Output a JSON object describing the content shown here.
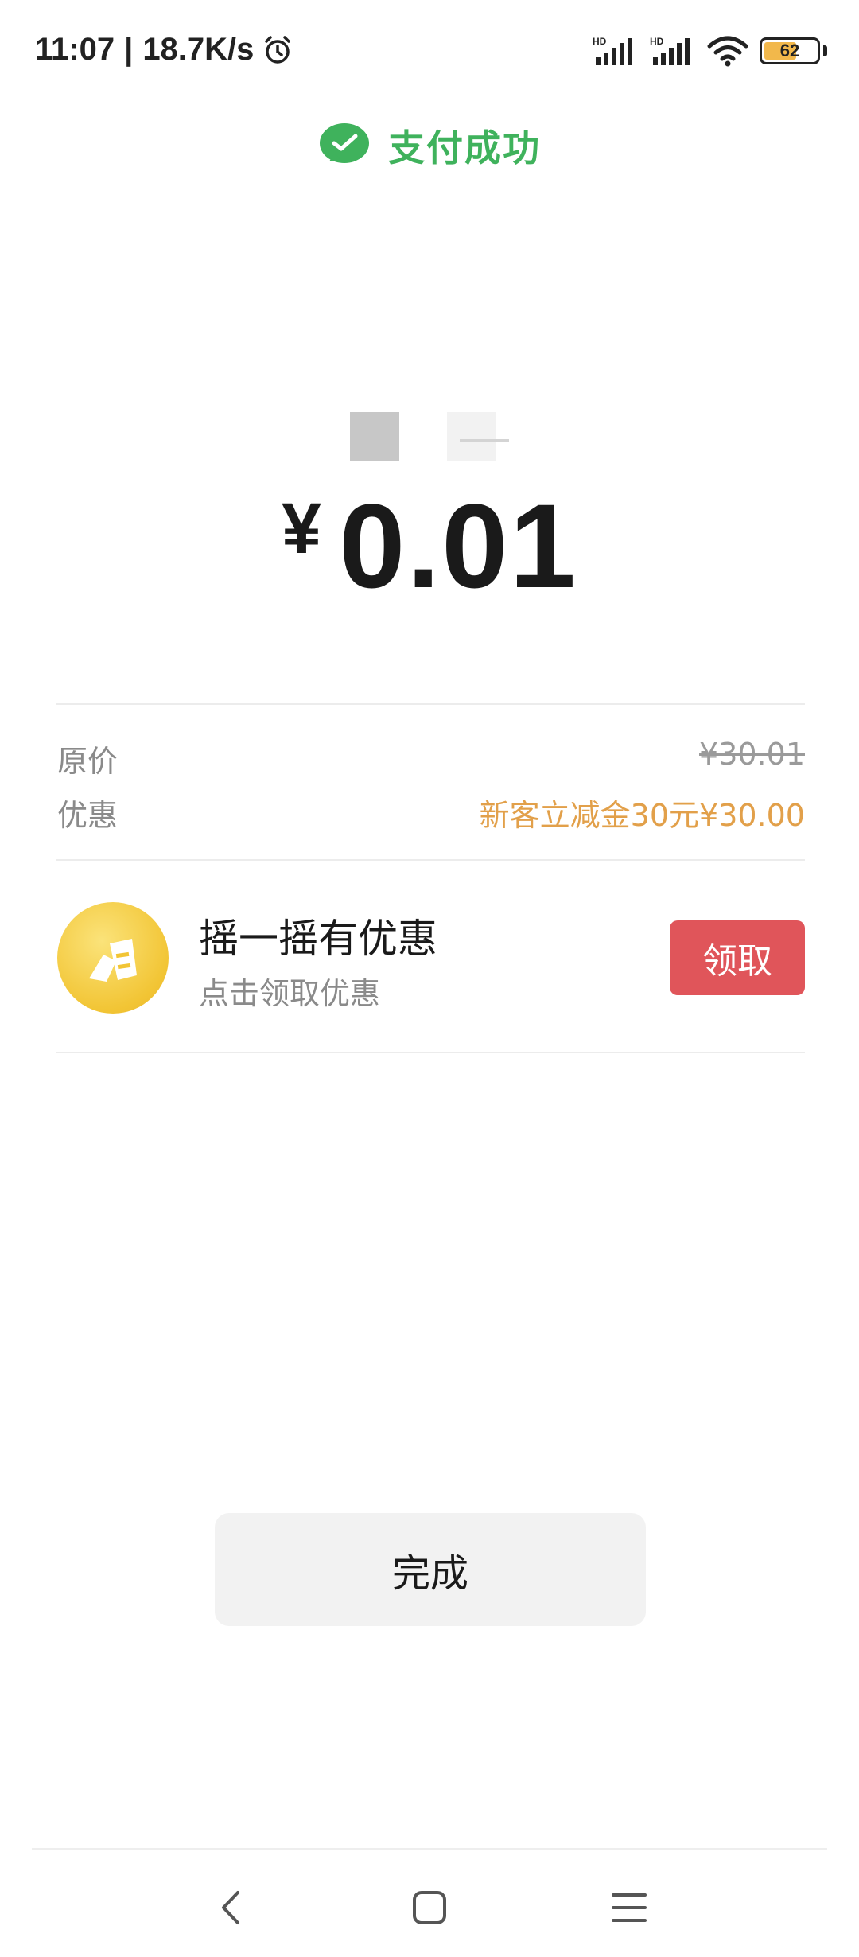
{
  "status_bar": {
    "time": "11:07",
    "separator": "|",
    "network_speed": "18.7K/s",
    "signal_1_label": "HD",
    "signal_2_label": "HD",
    "battery_level": "62",
    "icons": [
      "alarm-icon",
      "signal-icon",
      "signal-icon",
      "wifi-icon",
      "battery-icon"
    ]
  },
  "header": {
    "title": "支付成功",
    "icon": "wechat-pay-check-icon",
    "accent_color": "#3fb25c"
  },
  "payment": {
    "currency_symbol": "¥",
    "amount": "0.01"
  },
  "price_details": {
    "original_label": "原价",
    "original_value": "¥30.01",
    "discount_label": "优惠",
    "discount_value": "新客立减金30元¥30.00",
    "discount_color": "#e2a04a"
  },
  "promo": {
    "title": "摇一摇有优惠",
    "subtitle": "点击领取优惠",
    "button_label": "领取",
    "button_color": "#e0555a",
    "icon": "coupon-icon"
  },
  "actions": {
    "done_label": "完成"
  },
  "nav_bar": {
    "icons": [
      "back-icon",
      "home-icon",
      "menu-icon"
    ]
  }
}
